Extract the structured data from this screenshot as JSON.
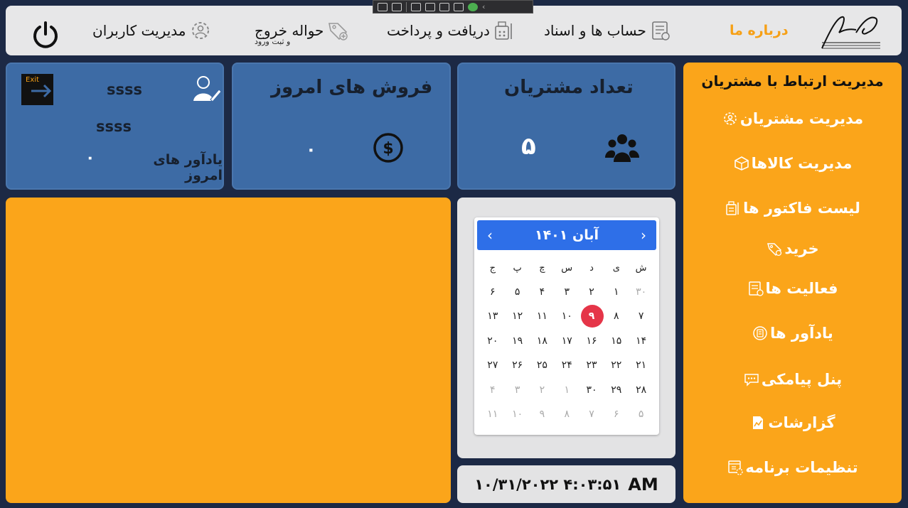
{
  "topbar": {
    "about": "درباره ما",
    "accounts": "حساب ها و اسناد",
    "payments": "دریافت و پرداخت",
    "transfer": "حواله خروج",
    "transfer_sub": "و ثبت ورود",
    "users": "مدیریت کاربران"
  },
  "user_card": {
    "name": "ssss",
    "role": "ssss",
    "reminders_label": "یادآور های امروز",
    "reminders_count": "۰",
    "exit_label": "Exit"
  },
  "sales_card": {
    "title": "فروش های امروز",
    "value": "۰"
  },
  "customers_card": {
    "title": "تعداد مشتریان",
    "value": "۵"
  },
  "menu": {
    "title": "مدیریت ارتباط با مشتریان",
    "items": [
      {
        "label": "مدیریت مشتریان",
        "icon": "customers-settings-icon"
      },
      {
        "label": "مدیریت کالاها",
        "icon": "box-icon"
      },
      {
        "label": "لیست فاکتور ها",
        "icon": "invoice-list-icon"
      },
      {
        "label": "خرید",
        "icon": "tag-icon"
      },
      {
        "label": "فعالیت ها",
        "icon": "activity-icon"
      },
      {
        "label": "یادآور ها",
        "icon": "reminder-icon"
      },
      {
        "label": "پنل پیامکی",
        "icon": "sms-icon"
      },
      {
        "label": "گزارشات",
        "icon": "report-icon"
      },
      {
        "label": "تنظیمات برنامه",
        "icon": "settings-icon"
      }
    ]
  },
  "calendar": {
    "month_label": "آبان ۱۴۰۱",
    "weekdays": [
      "ش",
      "ی",
      "د",
      "س",
      "چ",
      "پ",
      "ج"
    ],
    "weeks": [
      [
        {
          "d": "۳۰",
          "m": true
        },
        {
          "d": "۱"
        },
        {
          "d": "۲"
        },
        {
          "d": "۳"
        },
        {
          "d": "۴"
        },
        {
          "d": "۵"
        },
        {
          "d": "۶"
        }
      ],
      [
        {
          "d": "۷"
        },
        {
          "d": "۸"
        },
        {
          "d": "۹",
          "today": true
        },
        {
          "d": "۱۰"
        },
        {
          "d": "۱۱"
        },
        {
          "d": "۱۲"
        },
        {
          "d": "۱۳"
        }
      ],
      [
        {
          "d": "۱۴"
        },
        {
          "d": "۱۵"
        },
        {
          "d": "۱۶"
        },
        {
          "d": "۱۷"
        },
        {
          "d": "۱۸"
        },
        {
          "d": "۱۹"
        },
        {
          "d": "۲۰"
        }
      ],
      [
        {
          "d": "۲۱"
        },
        {
          "d": "۲۲"
        },
        {
          "d": "۲۳"
        },
        {
          "d": "۲۴"
        },
        {
          "d": "۲۵"
        },
        {
          "d": "۲۶"
        },
        {
          "d": "۲۷"
        }
      ],
      [
        {
          "d": "۲۸"
        },
        {
          "d": "۲۹"
        },
        {
          "d": "۳۰"
        },
        {
          "d": "۱",
          "m": true
        },
        {
          "d": "۲",
          "m": true
        },
        {
          "d": "۳",
          "m": true
        },
        {
          "d": "۴",
          "m": true
        }
      ],
      [
        {
          "d": "۵",
          "m": true
        },
        {
          "d": "۶",
          "m": true
        },
        {
          "d": "۷",
          "m": true
        },
        {
          "d": "۸",
          "m": true
        },
        {
          "d": "۹",
          "m": true
        },
        {
          "d": "۱۰",
          "m": true
        },
        {
          "d": "۱۱",
          "m": true
        }
      ]
    ]
  },
  "clock": {
    "datetime": "۱۰/۳۱/۲۰۲۲ ۴:۰۳:۵۱",
    "ampm": "AM"
  },
  "colors": {
    "background": "#1c2945",
    "card_blue": "#3d6ba5",
    "accent_orange": "#fba51a",
    "calendar_header": "#2e6fe8",
    "today": "#e53548"
  }
}
